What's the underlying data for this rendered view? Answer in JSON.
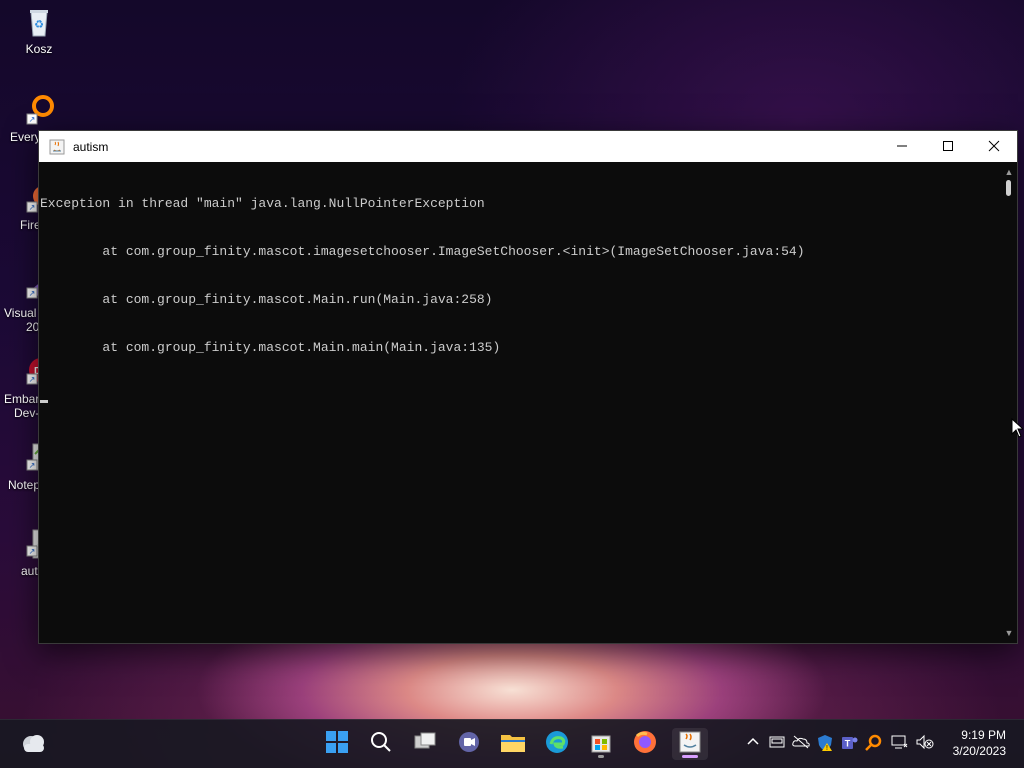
{
  "desktop": {
    "icons": [
      {
        "label": "Kosz",
        "icon": "recycle-bin-icon"
      },
      {
        "label": "Every",
        "icon": "everything-search-icon"
      },
      {
        "label": "Fire",
        "icon": "firefox-icon"
      },
      {
        "label": "Visual",
        "label2": "20",
        "icon": "visual-studio-icon"
      },
      {
        "label": "Embar",
        "label2": "Dev-",
        "icon": "embarcadero-dev-cpp-icon"
      },
      {
        "label": "Notep",
        "icon": "notepad-plus-plus-icon"
      },
      {
        "label": "auti",
        "icon": "java-app-icon"
      }
    ]
  },
  "window": {
    "title": "autism",
    "controls": {
      "minimize": "minimize-icon",
      "maximize": "maximize-icon",
      "close": "close-icon"
    }
  },
  "console": {
    "lines": [
      "Exception in thread \"main\" java.lang.NullPointerException",
      "        at com.group_finity.mascot.imagesetchooser.ImageSetChooser.<init>(ImageSetChooser.java:54)",
      "        at com.group_finity.mascot.Main.run(Main.java:258)",
      "        at com.group_finity.mascot.Main.main(Main.java:135)"
    ]
  },
  "taskbar": {
    "apps": [
      "start-icon",
      "search-icon",
      "task-view-icon",
      "teams-chat-icon",
      "file-explorer-icon",
      "edge-icon",
      "store-icon",
      "firefox-icon",
      "java-icon"
    ],
    "tray": [
      "chevron-up-icon",
      "drive-icon",
      "onedrive-icon",
      "defender-icon",
      "teams-icon",
      "everything-icon",
      "network-icon",
      "volume-muted-icon"
    ],
    "time": "9:19 PM",
    "date": "3/20/2023",
    "weather": "weather-cloud-icon"
  },
  "colors": {
    "console_bg": "#0c0c0c",
    "console_text": "#cccccc",
    "titlebar_bg": "#ffffff",
    "taskbar_bg": "#181822"
  }
}
